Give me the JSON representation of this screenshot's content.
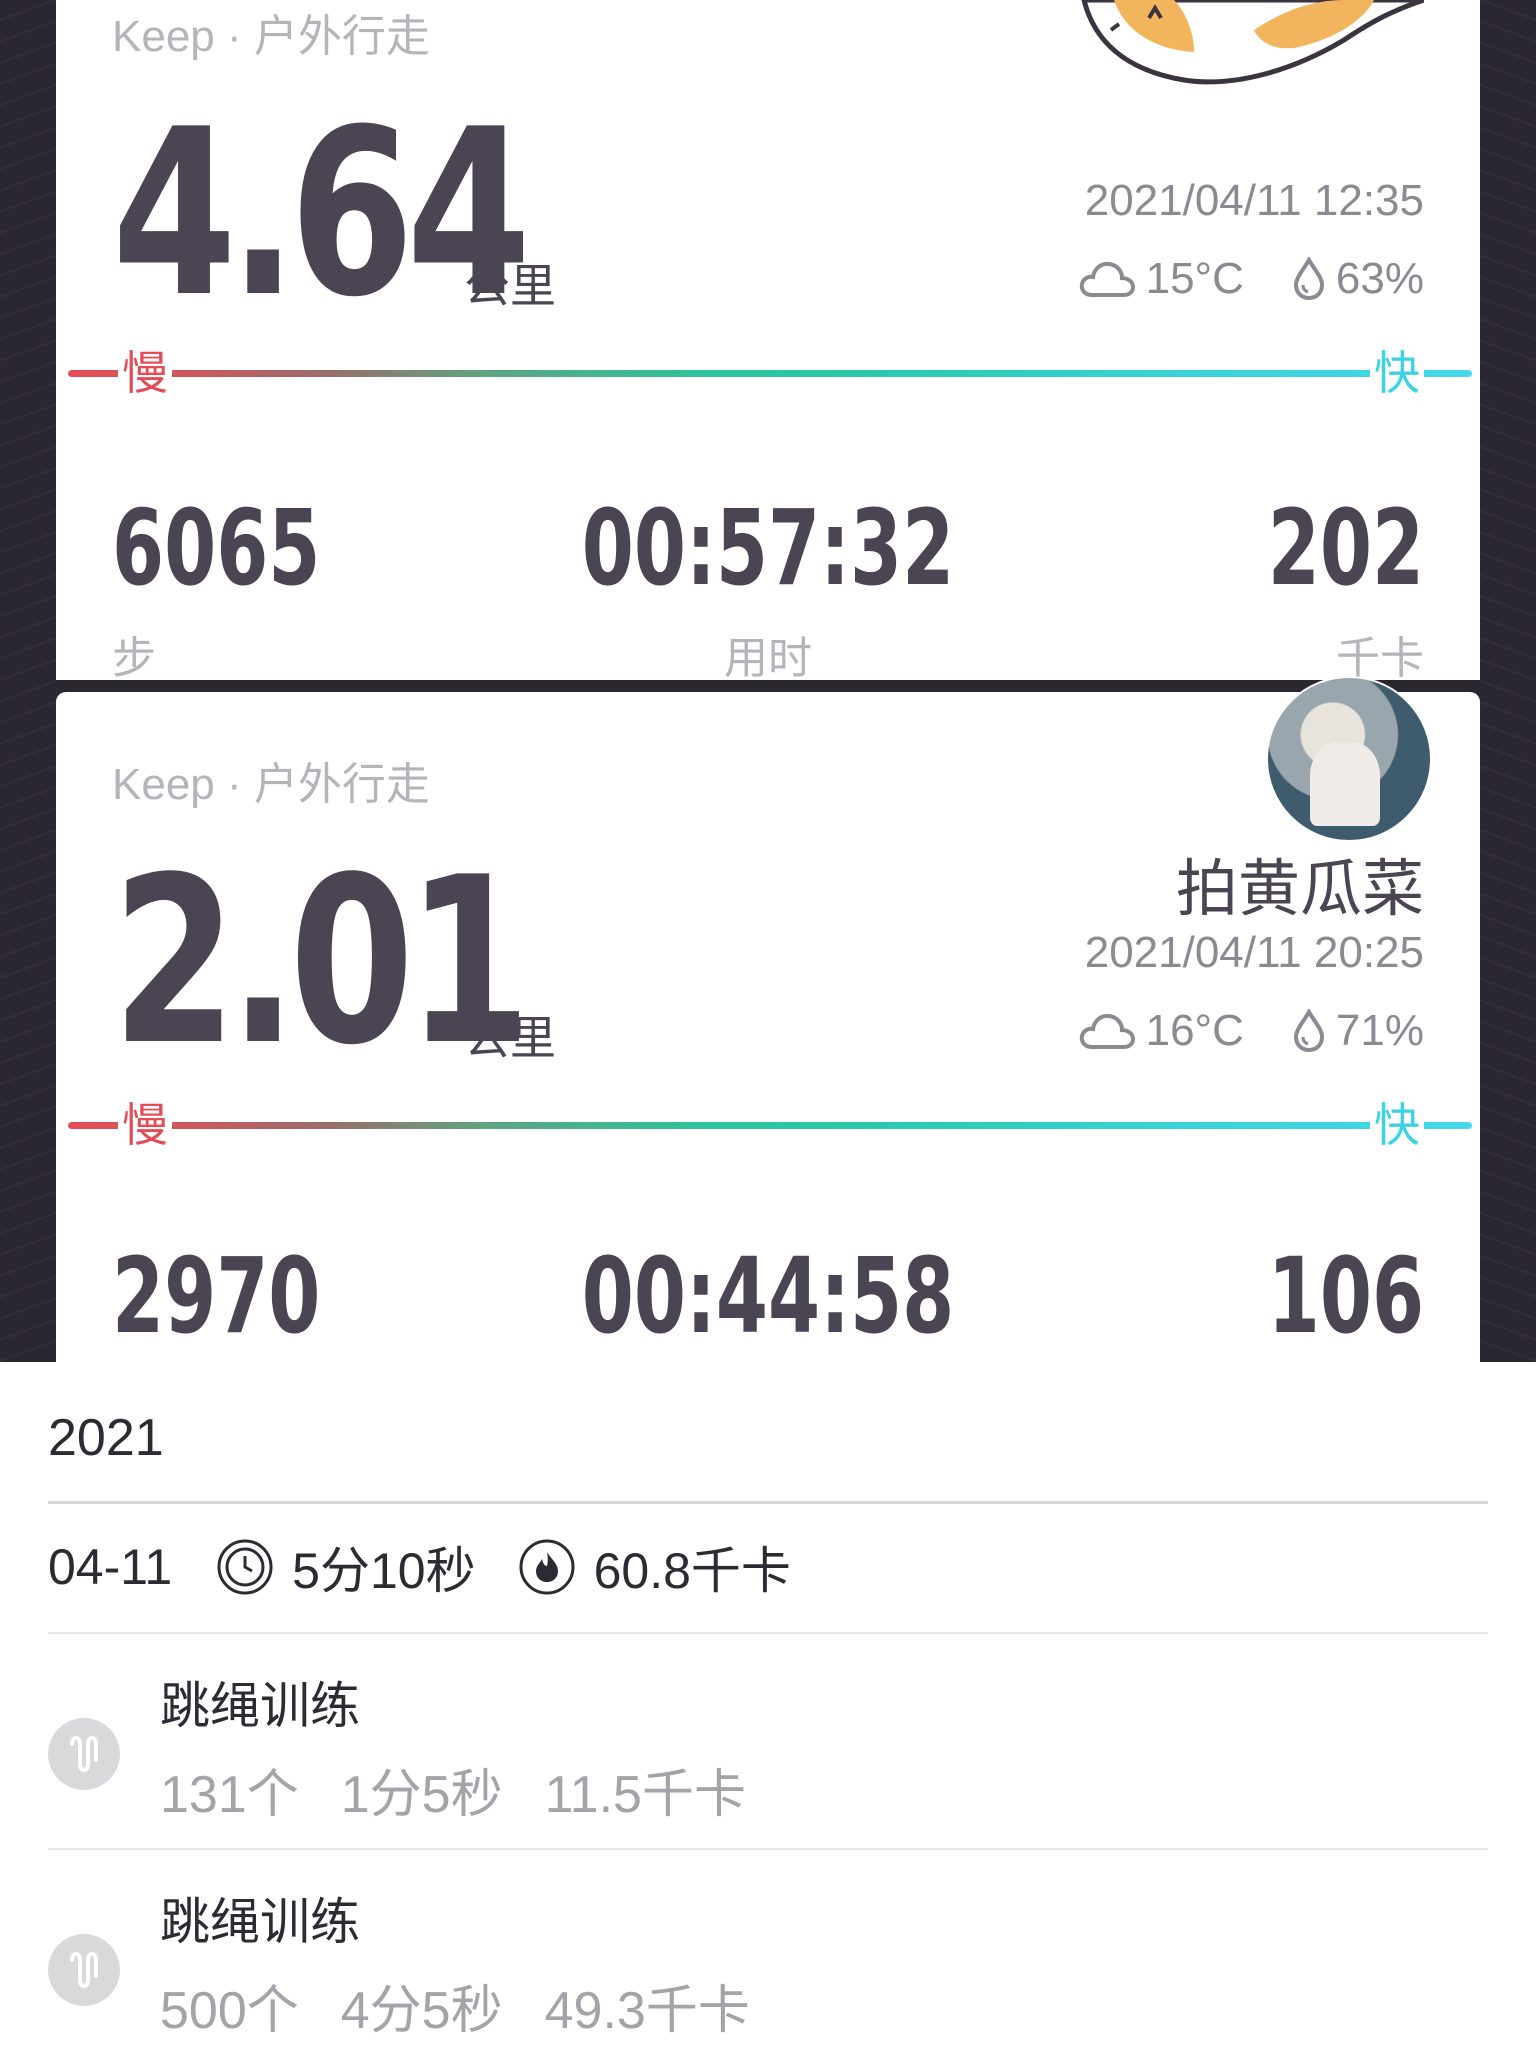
{
  "card1": {
    "subtitle": "Keep · 户外行走",
    "distance": "4.64",
    "distance_unit": "公里",
    "datetime": "2021/04/11 12:35",
    "temperature": "15°C",
    "humidity": "63%",
    "speed_slow": "慢",
    "speed_fast": "快",
    "steps": "6065",
    "steps_label": "步",
    "duration": "00:57:32",
    "duration_label": "用时",
    "calories": "202",
    "calories_label": "千卡"
  },
  "card2": {
    "subtitle": "Keep · 户外行走",
    "distance": "2.01",
    "distance_unit": "公里",
    "username": "拍黄瓜菜",
    "datetime": "2021/04/11 20:25",
    "temperature": "16°C",
    "humidity": "71%",
    "speed_slow": "慢",
    "speed_fast": "快",
    "steps": "2970",
    "duration": "00:44:58",
    "calories": "106"
  },
  "history": {
    "year": "2021",
    "summary": {
      "date": "04-11",
      "duration": "5分10秒",
      "calories": "60.8千卡",
      "duration_icon": "clock-icon",
      "calories_icon": "flame-icon"
    },
    "workouts": [
      {
        "title": "跳绳训练",
        "count": "131个",
        "duration": "1分5秒",
        "calories": "11.5千卡",
        "icon": "jump-rope-icon"
      },
      {
        "title": "跳绳训练",
        "count": "500个",
        "duration": "4分5秒",
        "calories": "49.3千卡",
        "icon": "jump-rope-icon"
      }
    ]
  },
  "colors": {
    "text_dark": "#4a4453",
    "slow": "#e24e57",
    "fast": "#3cd2e3",
    "background_dark": "#2b2731"
  }
}
